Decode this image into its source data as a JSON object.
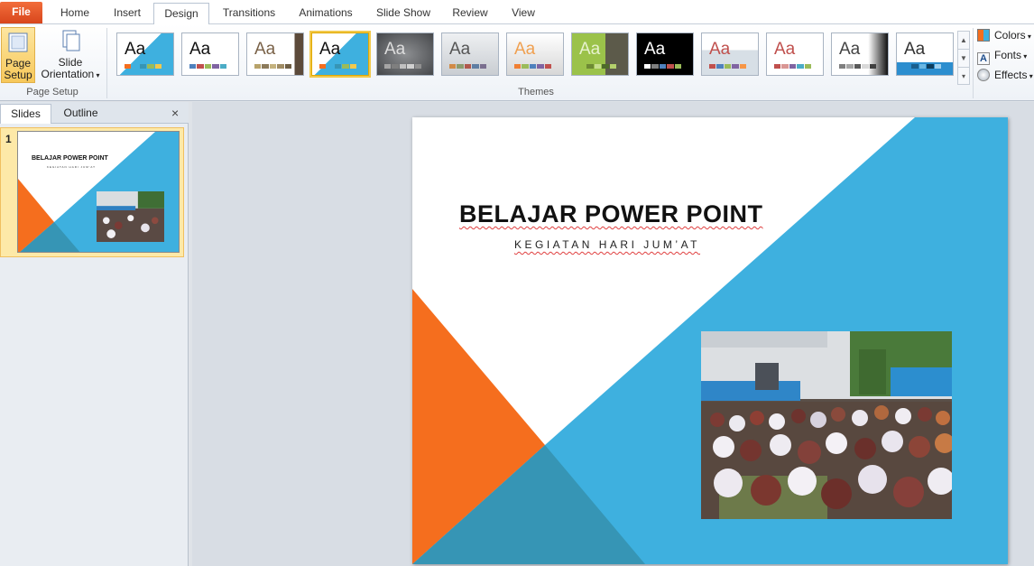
{
  "tabs": {
    "file": "File",
    "home": "Home",
    "insert": "Insert",
    "design": "Design",
    "transitions": "Transitions",
    "animations": "Animations",
    "slideshow": "Slide Show",
    "review": "Review",
    "view": "View"
  },
  "ribbon": {
    "page_setup_label": "Page Setup",
    "slide_orientation_label": "Slide Orientation",
    "page_setup_group": "Page Setup",
    "themes_group": "Themes",
    "colors_label": "Colors",
    "fonts_label": "Fonts",
    "effects_label": "Effects",
    "theme_sample": "Aa",
    "theme_count": 13,
    "selected_theme_index": 3
  },
  "left_pane": {
    "slides_tab": "Slides",
    "outline_tab": "Outline",
    "close_glyph": "×",
    "slide_number": "1"
  },
  "slide": {
    "title": "BELAJAR POWER POINT",
    "subtitle": "KEGIATAN HARI JUM’AT"
  },
  "colors": {
    "accent_blue": "#3eb0df",
    "accent_orange": "#f56e1e",
    "accent_teal": "#3695b5",
    "file_tab": "#e3521a"
  }
}
